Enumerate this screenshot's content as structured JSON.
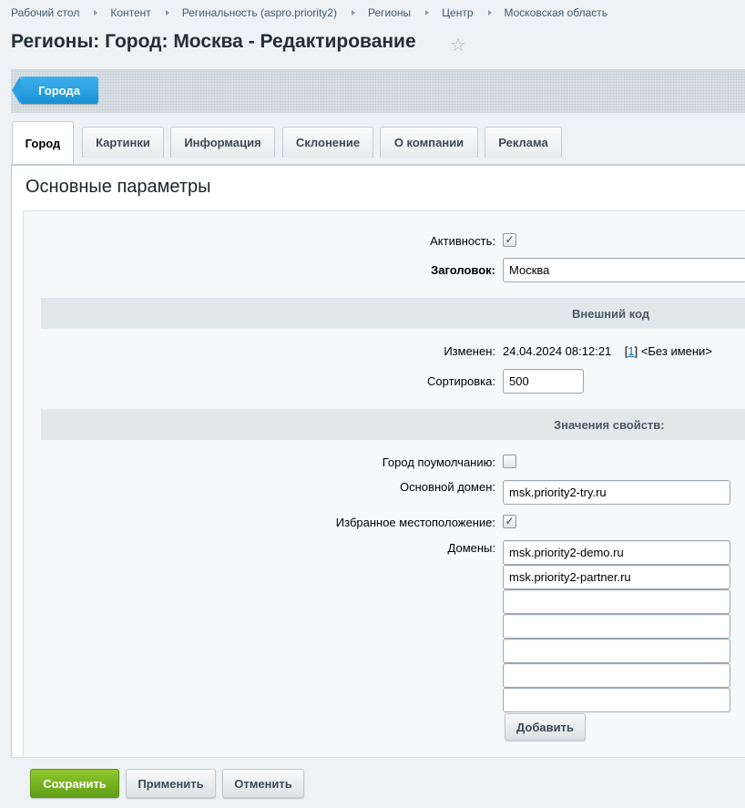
{
  "breadcrumb": [
    "Рабочий стол",
    "Контент",
    "Регинальность (aspro.priority2)",
    "Регионы",
    "Центр",
    "Московская область"
  ],
  "page_title": "Регионы: Город: Москва - Редактирование",
  "star_icon": "star-icon",
  "back_button": "Города",
  "tabs": [
    "Город",
    "Картинки",
    "Информация",
    "Склонение",
    "О компании",
    "Реклама"
  ],
  "active_tab": "Город",
  "section_title": "Основные параметры",
  "fields": {
    "active_label": "Активность:",
    "active_checked": true,
    "title_label": "Заголовок:",
    "title_value": "Москва",
    "external_code_label": "Внешний код",
    "modified_label": "Изменен:",
    "modified_date": "24.04.2024 08:12:21",
    "modified_user_id": "1",
    "modified_user_name": "<Без имени>",
    "sort_label": "Сортировка:",
    "sort_value": "500"
  },
  "properties": {
    "header": "Значения свойств:",
    "default_city_label": "Город поумолчанию:",
    "default_city_checked": false,
    "main_domain_label": "Основной домен:",
    "main_domain_value": "msk.priority2-try.ru",
    "favorite_label": "Избранное местоположение:",
    "favorite_checked": true,
    "domains_label": "Домены:",
    "domains": [
      "msk.priority2-demo.ru",
      "msk.priority2-partner.ru",
      "",
      "",
      "",
      "",
      ""
    ],
    "add_button": "Добавить"
  },
  "footer": {
    "save": "Сохранить",
    "apply": "Применить",
    "cancel": "Отменить"
  },
  "colors": {
    "accent_blue": "#1991d6",
    "save_green": "#6aa81a",
    "link": "#2067b0"
  }
}
